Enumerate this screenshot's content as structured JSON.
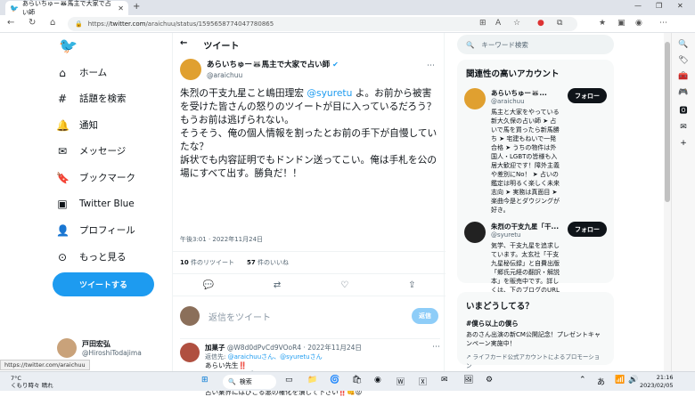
{
  "browser": {
    "tab_title": "あらいちゅー🦝馬主で大家で占い師",
    "url_prefix": "https://",
    "url_domain": "twitter.com",
    "url_path": "/araichuu/status/1595658774047780865"
  },
  "nav": {
    "items": [
      "ホーム",
      "話題を検索",
      "通知",
      "メッセージ",
      "ブックマーク",
      "Twitter Blue",
      "プロフィール",
      "もっと見る"
    ],
    "tweet_button": "ツイートする",
    "me_name": "戸田宏弘",
    "me_handle": "@HiroshiTodajima"
  },
  "main": {
    "header": "ツイート",
    "author_name": "あらいちゅー🦝馬主で大家で占い師",
    "author_handle": "@araichuu",
    "text_before": "朱烈の干支九星こと嶋田理宏 ",
    "mention": "@syuretu",
    "text_after": " よ。お前から被害を受けた皆さんの怒りのツイートが目に入っているだろう？\nもうお前は逃げられない。\nそうそう、俺の個人情報を割ったとお前の手下が自慢していたな？\n訴状でも内容証明でもドンドン送ってこい。俺は手札を公の場にすべて出す。勝負だ！！",
    "timestamp": "午後3:01 · 2022年11月24日",
    "retweets_count": "10",
    "retweets_label": "件のリツイート",
    "likes_count": "57",
    "likes_label": "件のいいね",
    "reply_placeholder": "返信をツイート",
    "reply_button": "返信",
    "reply": {
      "name": "加菓子",
      "handle": "@W8d0dPvCd9VOoR4 · 2022年11月24日",
      "to_label": "返信先: ",
      "to_users": "@araichuuさん、@syuretuさん",
      "body": "あらい先生‼️\n頑張って👊😆🎵\n応援してます‼️\n占い業界にはびこる悪の権化を潰して下さい‼️👊😡"
    }
  },
  "right": {
    "search_placeholder": "キーワード検索",
    "related_title": "関連性の高いアカウント",
    "accounts": [
      {
        "name": "あらいちゅー🦝...",
        "handle": "@araichuu",
        "follow": "フォロー",
        "bio": "馬主と大家をやっている新大久保の占い師 ➤ 占いで馬を買ったら新馬勝ち ➤ 宅建もねいで一発合格 ➤ うちの物件は外国人・LGBTの皆様も入居大歓迎です！障外主義や差別にNo！ ➤ 占いの鑑定は明るく楽しく未来志向 ➤ 実務は真面目 ➤ 楽曲今是とダウジングが好き。"
      },
      {
        "name": "朱烈の干支九星「干...",
        "handle": "@syuretu",
        "follow": "フォロー",
        "bio": "気学、干支九星を追求しています。太玄社「干支九星秘伝録」と自費出版「郷氏元経の翻訳・解説本」を販売中です。詳しくは、下のブログのURLをご覧下さい。また横浜近郊で対面鑑定、メール鑑定もご要望がありましたら致します。詳細はDMやメールを下さればお知らせ致します。"
      }
    ],
    "trends_title": "いまどうしてる？",
    "trend_title": "#僕ら以上の僕ら",
    "trend_desc": "あのさん出演の新CM公開記念！プレゼントキャンペーン実施中！",
    "trend_promo": "ライフカード公式アカウントによるプロモーション"
  },
  "status_url": "https://twitter.com/araichuu",
  "taskbar": {
    "weather_temp": "7°C",
    "weather_desc": "くもり時々 晴れ",
    "search_label": "検索",
    "time": "21:16",
    "date": "2023/02/05"
  }
}
